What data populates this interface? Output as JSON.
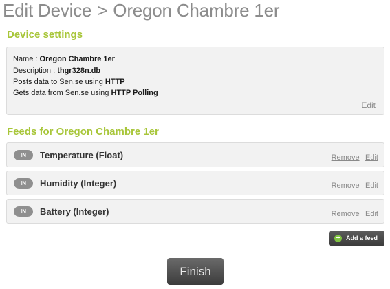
{
  "page": {
    "title_prefix": "Edit Device",
    "separator": ">",
    "device_name": "Oregon Chambre 1er"
  },
  "settings": {
    "heading": "Device settings",
    "name_label": "Name : ",
    "name_value": "Oregon Chambre 1er",
    "description_label": "Description : ",
    "description_value": "thgr328n.db",
    "posts_label": "Posts data to Sen.se using ",
    "posts_value": "HTTP",
    "gets_label": "Gets data from Sen.se using ",
    "gets_value": "HTTP Polling",
    "edit_label": "Edit"
  },
  "feeds": {
    "heading": "Feeds for Oregon Chambre 1er",
    "items": [
      {
        "badge": "IN",
        "name": "Temperature (Float)",
        "remove": "Remove",
        "edit": "Edit"
      },
      {
        "badge": "IN",
        "name": "Humidity (Integer)",
        "remove": "Remove",
        "edit": "Edit"
      },
      {
        "badge": "IN",
        "name": "Battery (Integer)",
        "remove": "Remove",
        "edit": "Edit"
      }
    ],
    "add_label": "Add a feed",
    "add_icon": "plus-circle-icon"
  },
  "finish_label": "Finish",
  "colors": {
    "heading": "#a8c63a",
    "title": "#8c8c8c",
    "badge": "#8f8f8f",
    "add_icon": "#7fc241"
  }
}
